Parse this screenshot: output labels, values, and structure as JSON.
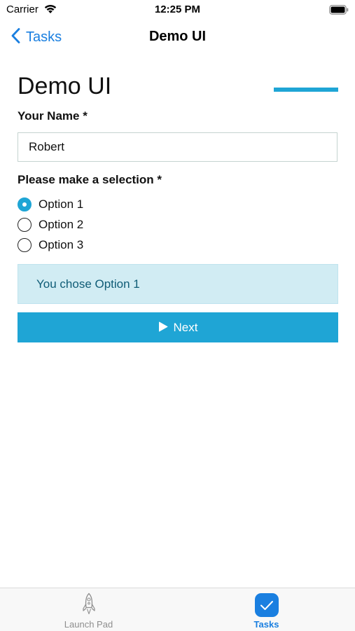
{
  "status_bar": {
    "carrier": "Carrier",
    "time": "12:25 PM"
  },
  "nav": {
    "back_label": "Tasks",
    "title": "Demo UI"
  },
  "form": {
    "title": "Demo UI",
    "name_label": "Your Name *",
    "name_value": "Robert",
    "selection_label": "Please make a selection *",
    "options": [
      {
        "label": "Option 1",
        "selected": true
      },
      {
        "label": "Option 2",
        "selected": false
      },
      {
        "label": "Option 3",
        "selected": false
      }
    ],
    "result_text": "You chose Option 1",
    "next_label": "Next"
  },
  "tab_bar": {
    "items": [
      {
        "label": "Launch Pad",
        "icon": "rocket-icon",
        "active": false
      },
      {
        "label": "Tasks",
        "icon": "checkmark-icon",
        "active": true
      }
    ]
  },
  "colors": {
    "accent": "#1fa5d5",
    "ios_blue": "#1a7fe0",
    "info_bg": "#d1ecf3",
    "info_text": "#0f5c76"
  }
}
